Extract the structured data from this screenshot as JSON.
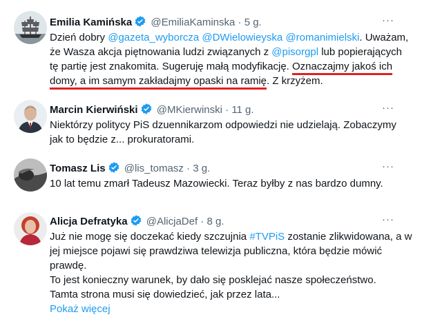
{
  "tweets": [
    {
      "name": "Emilia Kamińska",
      "handle": "@EmiliaKaminska",
      "sep": "·",
      "time": "5 g.",
      "more": "···",
      "text": {
        "p1": "Dzień dobry ",
        "m1": "@gazeta_wyborcza",
        "p2": " ",
        "m2": "@DWielowieyska",
        "p3": " ",
        "m3": "@romanimielski",
        "p4": ". Uważam, że Wasza akcja piętnowania ludzi związanych z ",
        "m4": "@pisorgpl",
        "p5": " lub popierających tę partię jest znakomita. Sugeruję małą modyfikację. ",
        "u1": "Oznaczajmy jakoś ich domy, a im samym zakładajmy opaski na ramię",
        "p6": ". Z krzyżem."
      }
    },
    {
      "name": "Marcin Kierwiński",
      "handle": "@MKierwinski",
      "sep": "·",
      "time": "11 g.",
      "more": "···",
      "text": "Niektórzy politycy PiS dzuennikarzom odpowiedzi nie udzielają. Zobaczymy jak to będzie z... prokuratorami."
    },
    {
      "name": "Tomasz Lis",
      "handle": "@lis_tomasz",
      "sep": "·",
      "time": "3 g.",
      "more": "···",
      "text": "10 lat temu zmarł Tadeusz Mazowiecki. Teraz byłby z nas bardzo dumny."
    },
    {
      "name": "Alicja Defratyka",
      "handle": "@AlicjaDef",
      "sep": "·",
      "time": "8 g.",
      "more": "···",
      "text": {
        "p1": "Już nie mogę się doczekać kiedy szczujnia ",
        "m1": "#TVPiS",
        "p2": " zostanie zlikwidowana, a w jej miejsce pojawi się prawdziwa telewizja publiczna, która będzie mówić prawdę.",
        "p3": "To jest konieczny warunek, by dało się posklejać nasze społeczeństwo.",
        "p4": "Tamta strona musi się dowiedzieć, jak przez lata..."
      },
      "show_more": "Pokaż więcej"
    }
  ],
  "colors": {
    "link": "#1d9bf0",
    "verified": "#1d9bf0",
    "secondary": "#536471",
    "underline": "#e0201e"
  },
  "icons": [
    "verified-badge-icon",
    "more-options-icon"
  ]
}
